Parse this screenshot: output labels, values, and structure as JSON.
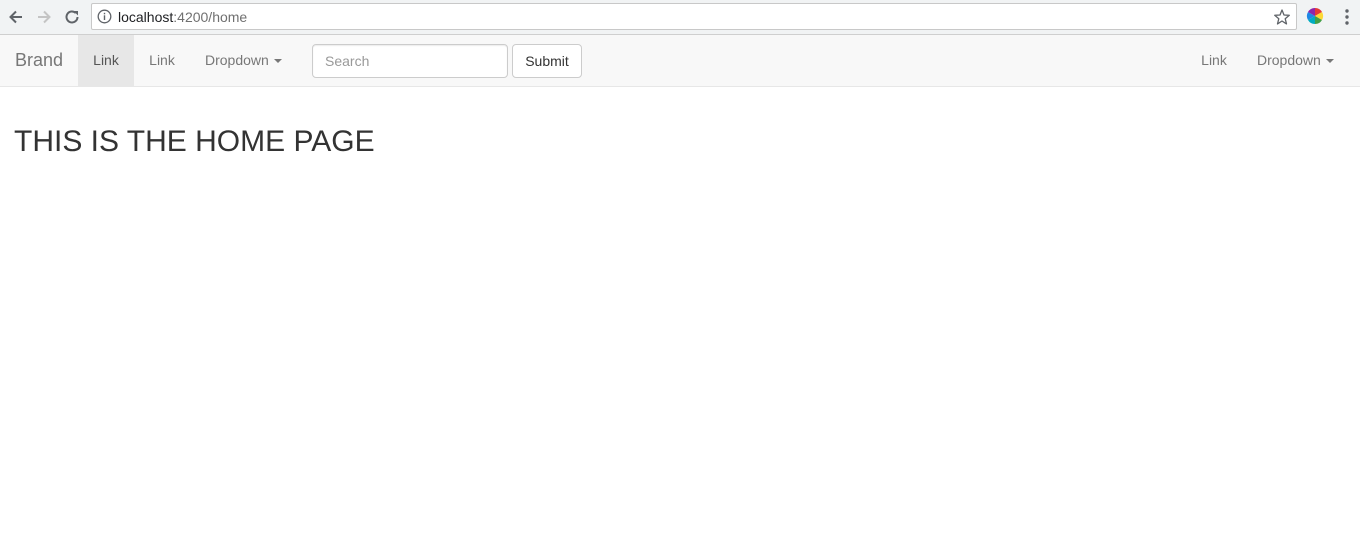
{
  "browser": {
    "url_host": "localhost",
    "url_path": ":4200/home",
    "icons": {
      "back": "back-arrow-icon",
      "forward": "forward-arrow-icon",
      "reload": "reload-icon",
      "info": "info-icon",
      "bookmark": "star-icon",
      "extension": "color-wheel-extension-icon",
      "menu": "kebab-menu-icon"
    }
  },
  "navbar": {
    "brand": "Brand",
    "left_links": [
      {
        "label": "Link",
        "active": true
      },
      {
        "label": "Link",
        "active": false
      }
    ],
    "left_dropdown": "Dropdown",
    "search": {
      "placeholder": "Search",
      "value": ""
    },
    "submit_label": "Submit",
    "right_link": "Link",
    "right_dropdown": "Dropdown"
  },
  "main": {
    "heading": "THIS IS THE HOME PAGE"
  },
  "colors": {
    "navbar_bg": "#f8f8f8",
    "active_link_bg": "#e7e7e7",
    "link_text": "#777777",
    "heading_text": "#333333"
  }
}
